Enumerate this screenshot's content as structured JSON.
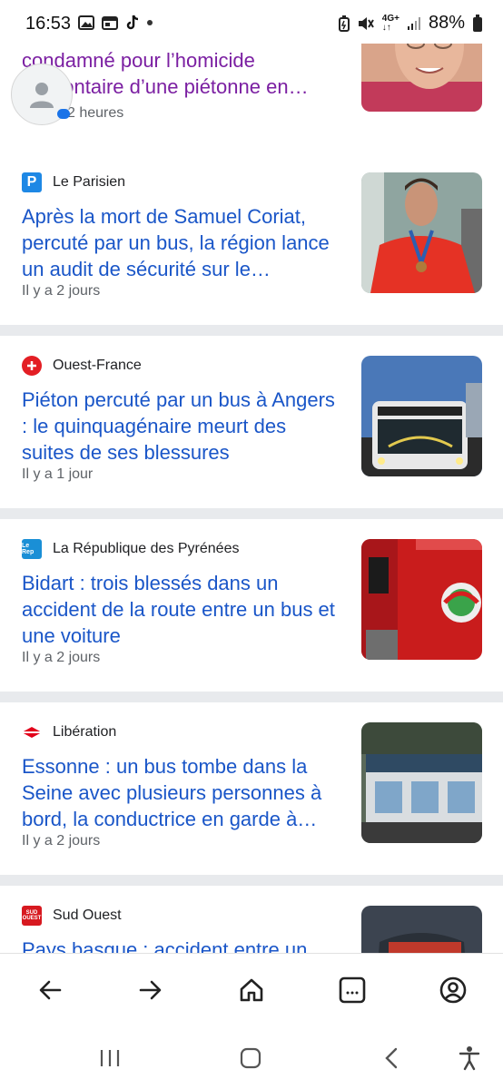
{
  "status_bar": {
    "time": "16:53",
    "battery_pct": "88%",
    "network": "4G+"
  },
  "articles": [
    {
      "source": "",
      "headline": "condamné pour l’homicide involontaire d’une piétonne en…",
      "time": "2 heures",
      "visited": true,
      "image_icon": "elderly-woman-photo"
    },
    {
      "source": "Le Parisien",
      "logo_text": "P",
      "logo_color": "#1e88e5",
      "headline": "Après la mort de Samuel Coriat, percuté par un bus, la région lance un audit de sécurité sur le…",
      "time": "Il y a 2 jours",
      "image_icon": "athlete-photo"
    },
    {
      "source": "Ouest-France",
      "logo_color": "#e31e24",
      "headline": "Piéton percuté par un bus à Angers : le quinquagénaire meurt des suites de ses blessures",
      "time": "Il y a 1 jour",
      "image_icon": "bus-photo"
    },
    {
      "source": "La République des Pyrénées",
      "logo_text": "Le Rep",
      "logo_color": "#1a8fd6",
      "headline": "Bidart : trois blessés dans un accident de la route entre un bus et une voiture",
      "time": "Il y a 2 jours",
      "image_icon": "fire-truck-photo"
    },
    {
      "source": "Libération",
      "logo_color": "#e2001a",
      "headline": "Essonne : un bus tombe dans la Seine avec plusieurs personnes à bord, la conductrice en garde à…",
      "time": "Il y a 2 jours",
      "image_icon": "building-photo"
    },
    {
      "source": "Sud Ouest",
      "logo_text": "SUD OUEST",
      "logo_color": "#d71920",
      "headline": "Pays basque : accident entre un",
      "time": "",
      "image_icon": "firefighter-photo"
    }
  ],
  "colors": {
    "headline": "#1a56c8",
    "visited_headline": "#7b1fa2",
    "divider": "#e8eaed"
  }
}
